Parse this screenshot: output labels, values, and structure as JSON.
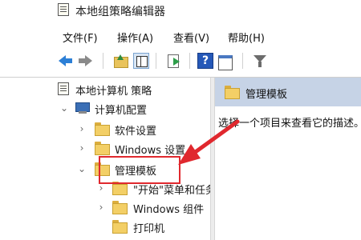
{
  "window": {
    "title": "本地组策略编辑器"
  },
  "menu": {
    "file": "文件(F)",
    "action": "操作(A)",
    "view": "查看(V)",
    "help": "帮助(H)"
  },
  "toolbar": {
    "help_glyph": "?"
  },
  "tree": {
    "root": "本地计算机 策略",
    "computer_config": "计算机配置",
    "software_settings": "软件设置",
    "windows_settings": "Windows 设置",
    "admin_templates": "管理模板",
    "start_menu": "\"开始\"菜单和任务栏",
    "windows_components": "Windows 组件",
    "printers": "打印机"
  },
  "detail": {
    "header": "管理模板",
    "description": "选择一个项目来查看它的描述。"
  },
  "colors": {
    "annotation_red": "#e0282e",
    "header_blue": "#c6d3e6"
  }
}
